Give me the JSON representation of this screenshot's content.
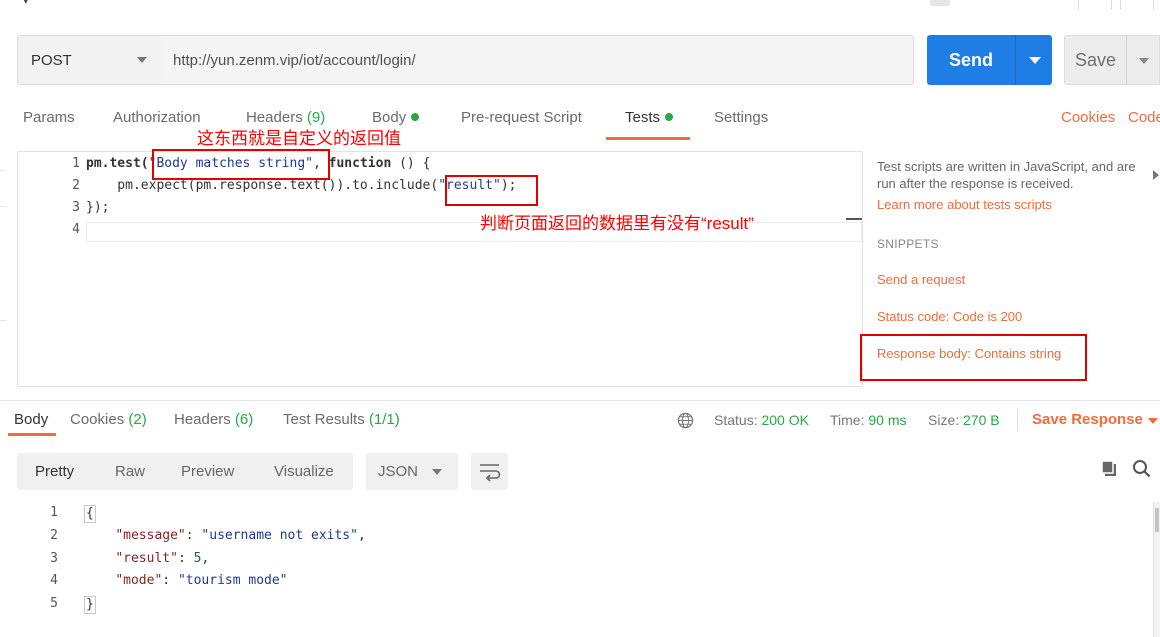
{
  "request": {
    "method": "POST",
    "url": "http://yun.zenm.vip/iot/account/login/",
    "send_label": "Send",
    "save_label": "Save"
  },
  "request_tabs": {
    "params": "Params",
    "authorization": "Authorization",
    "headers": "Headers",
    "headers_count": "(9)",
    "body": "Body",
    "pre_request": "Pre-request Script",
    "tests": "Tests",
    "settings": "Settings",
    "cookies": "Cookies",
    "code": "Code"
  },
  "editor": {
    "line_numbers": [
      "1",
      "2",
      "3",
      "4"
    ],
    "line1_a": "pm.test(",
    "line1_str": "\"Body matches string\"",
    "line1_b": ", ",
    "line1_kw": "function",
    "line1_c": " () {",
    "line2_a": "    pm.expect(pm.response.text()).to.include(",
    "line2_str": "\"result\"",
    "line2_b": ");",
    "line3": "});"
  },
  "annotations": {
    "custom_return": "这东西就是自定义的返回值",
    "check_result": "判断页面返回的数据里有没有“result”"
  },
  "right_panel": {
    "intro": "Test scripts are written in JavaScript, and are run after the response is received.",
    "learn_more": "Learn more about tests scripts",
    "snippets_heading": "SNIPPETS",
    "snippets": [
      "Send a request",
      "Status code: Code is 200",
      "Response body: Contains string"
    ]
  },
  "response_tabs": {
    "body": "Body",
    "cookies": "Cookies",
    "cookies_count": "(2)",
    "headers": "Headers",
    "headers_count": "(6)",
    "test_results": "Test Results",
    "test_results_count": "(1/1)"
  },
  "response_meta": {
    "status_label": "Status:",
    "status_value": "200 OK",
    "time_label": "Time:",
    "time_value": "90 ms",
    "size_label": "Size:",
    "size_value": "270 B",
    "save_response": "Save Response"
  },
  "response_view": {
    "pretty": "Pretty",
    "raw": "Raw",
    "preview": "Preview",
    "visualize": "Visualize",
    "format": "JSON"
  },
  "response_body": {
    "line_numbers": [
      "1",
      "2",
      "3",
      "4",
      "5"
    ],
    "open": "{",
    "close": "}",
    "message_key": "\"message\"",
    "message_value": "\"username not exits\"",
    "result_key": "\"result\"",
    "result_value": "5",
    "mode_key": "\"mode\"",
    "mode_value": "\"tourism mode\""
  },
  "colors": {
    "accent": "#f26b3a",
    "send_blue": "#1f7de6",
    "success_green": "#27a844",
    "annotation_red": "#ff0000"
  }
}
